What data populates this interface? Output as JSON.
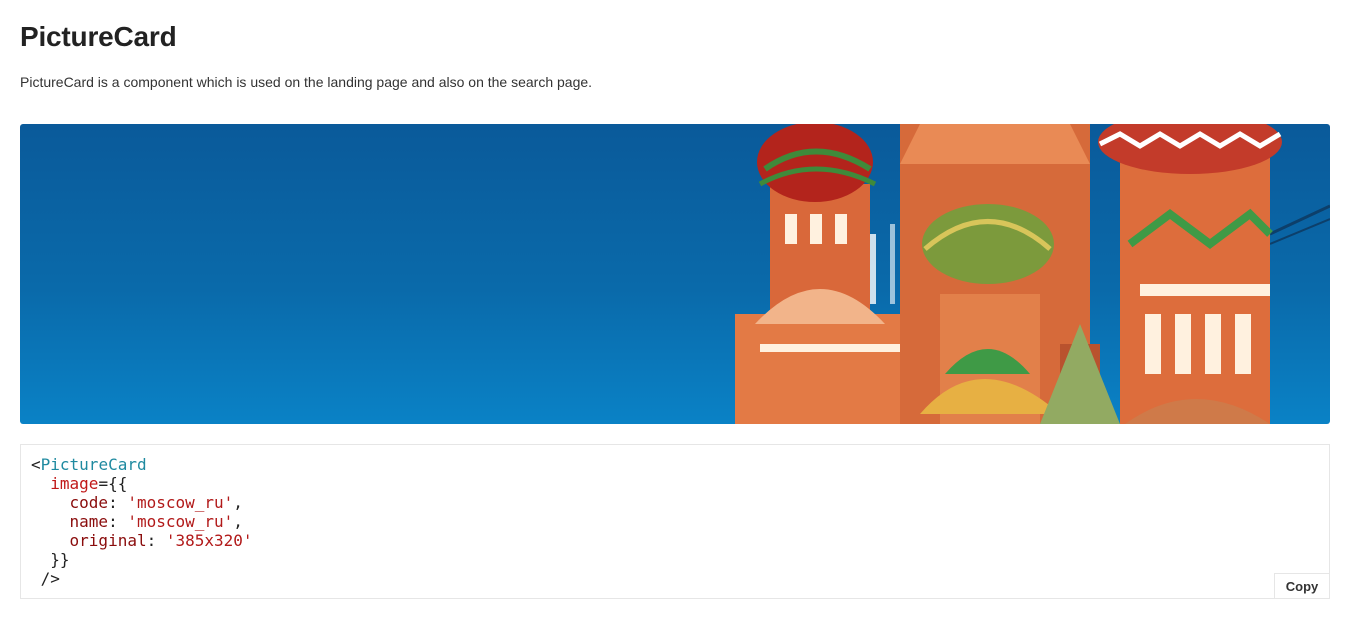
{
  "header": {
    "title": "PictureCard",
    "description": "PictureCard is a component which is used on the landing page and also on the search page."
  },
  "preview": {
    "image_description": "St. Basil's Cathedral domes against blue sky",
    "sky_color": "#0a6aaa"
  },
  "code": {
    "lt": "<",
    "component": "PictureCard",
    "attr": "image",
    "open": "={{",
    "entries": [
      {
        "key": "code",
        "value": "'moscow_ru'",
        "sep": ","
      },
      {
        "key": "name",
        "value": "'moscow_ru'",
        "sep": ","
      },
      {
        "key": "original",
        "value": "'385x320'",
        "sep": ""
      }
    ],
    "close": "}}",
    "end": "/>"
  },
  "actions": {
    "copy_label": "Copy"
  }
}
